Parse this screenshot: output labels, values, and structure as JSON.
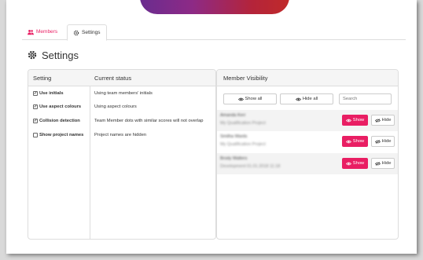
{
  "tabs": {
    "members_label": "Members",
    "settings_label": "Settings"
  },
  "page": {
    "title": "Settings"
  },
  "settings_panel": {
    "col_setting": "Setting",
    "col_status": "Current status",
    "rows": [
      {
        "label": "Use initials",
        "checked": true,
        "status": "Using team members' initials"
      },
      {
        "label": "Use aspect colours",
        "checked": true,
        "status": "Using aspect colours"
      },
      {
        "label": "Collision detection",
        "checked": true,
        "status": "Team Member dots with similar scores will not overlap"
      },
      {
        "label": "Show project names",
        "checked": false,
        "status": "Project names are hidden"
      }
    ]
  },
  "visibility_panel": {
    "title": "Member Visibility",
    "show_all_label": "Show all",
    "hide_all_label": "Hide all",
    "search_placeholder": "Search",
    "show_label": "Show",
    "hide_label": "Hide",
    "members": [
      {
        "name": "Amanda Kerr",
        "project": "My Qualification Project"
      },
      {
        "name": "Smitha Wards",
        "project": "My Qualification Project"
      },
      {
        "name": "Brody Walters",
        "project": "Development 01.01.2018 11:18"
      }
    ]
  },
  "colors": {
    "accent": "#e91e63",
    "panel_header": "#f5f5f5",
    "border": "#dddddd"
  },
  "icons": {
    "members_tab": "users-icon",
    "settings_tab": "gear-icon",
    "title": "gear-icon",
    "show": "eye-icon",
    "hide": "eye-slash-icon"
  }
}
